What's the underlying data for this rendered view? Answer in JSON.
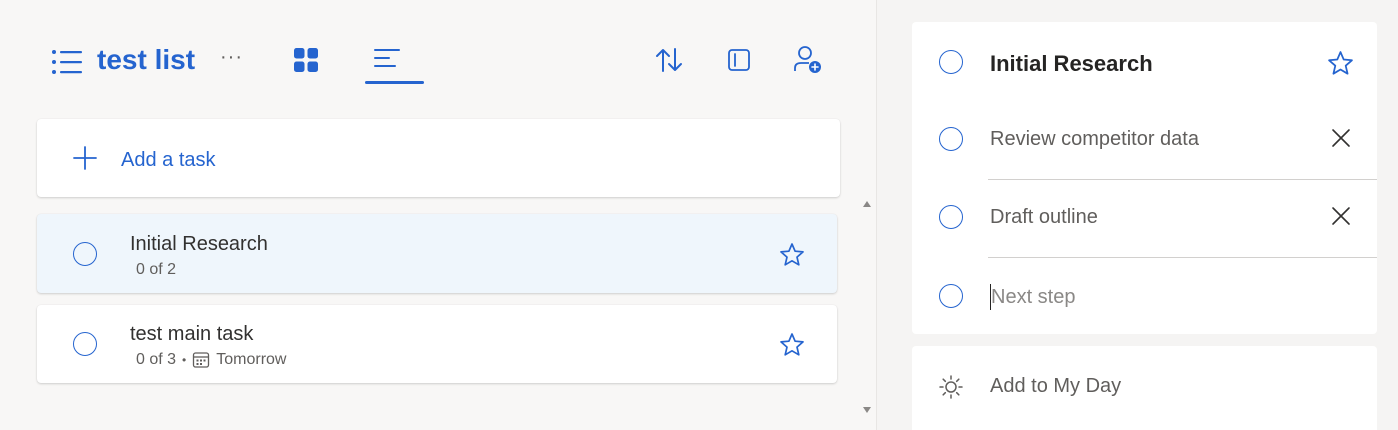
{
  "header": {
    "list_title": "test list",
    "more_label": "···"
  },
  "add_task": {
    "label": "Add a task"
  },
  "tasks": [
    {
      "title": "Initial Research",
      "steps": "0 of 2",
      "due": "",
      "selected": true
    },
    {
      "title": "test main task",
      "steps": "0 of 3",
      "due": "Tomorrow",
      "selected": false
    }
  ],
  "task_separator": "•",
  "detail": {
    "title": "Initial Research",
    "steps": [
      {
        "label": "Review competitor data"
      },
      {
        "label": "Draft outline"
      }
    ],
    "next_step_placeholder": "Next step",
    "add_to_my_day": "Add to My Day"
  },
  "colors": {
    "accent": "#2564cf",
    "selected_row": "#eff6fc"
  }
}
